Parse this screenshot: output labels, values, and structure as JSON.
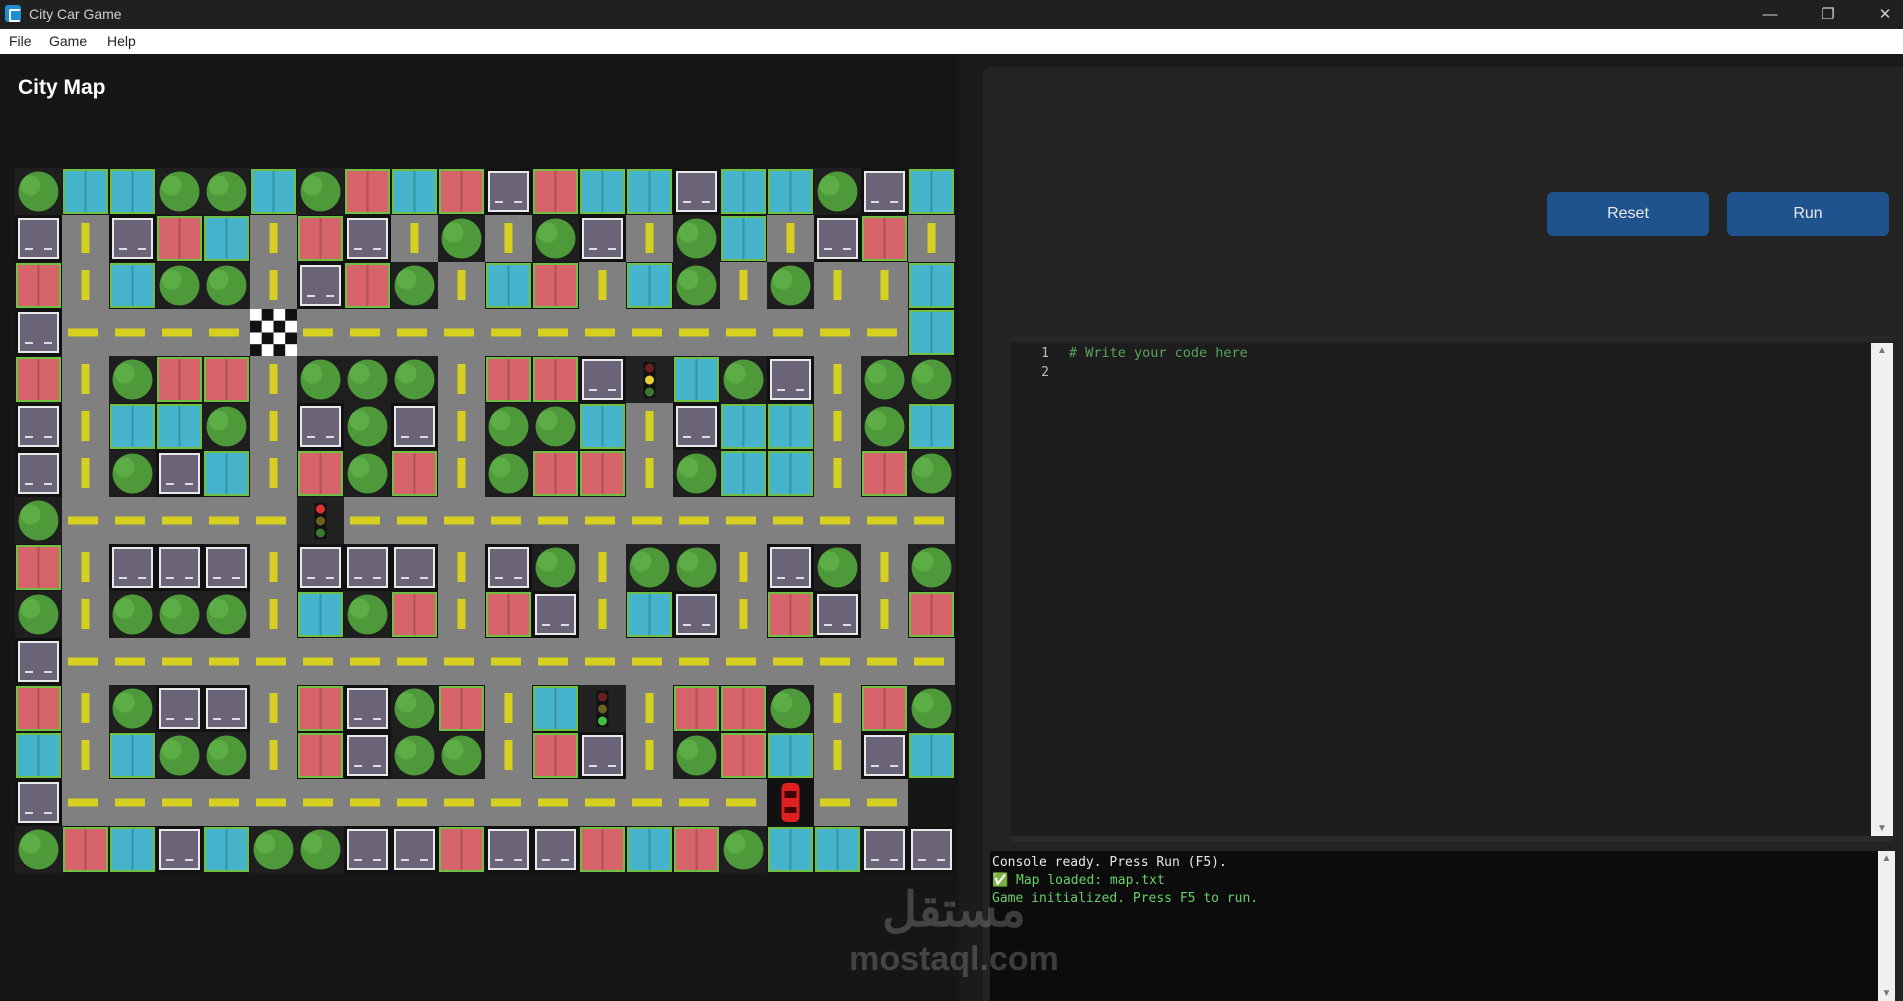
{
  "window": {
    "title": "City Car Game",
    "minimize_glyph": "—",
    "maximize_glyph": "❐",
    "close_glyph": "✕"
  },
  "menu": [
    "File",
    "Game",
    "Help"
  ],
  "map": {
    "title": "City Map",
    "grid": [
      "TCCTTCTRCRGRCCGCCTGC",
      "G.GRC.RG.T.TG.TC.GR.",
      "R.CTT.GRT.CR.CT.T..C",
      "G....F.............C",
      "R.TRR.TTT.RRG.CTG.TT",
      "G.CCT.GTG.TTC.GCC.TC",
      "G.TGC.RTR.TRR.TCC.RT",
      "T...................T",
      "R.GGG.GGG.GT.TT.GT.T",
      "T.TTT.CTR.RG.CG.RG.R",
      "G...................T",
      "R.TGG.RGTR.CC.RRT.RTT",
      "C.CTT.RGTT.RG.TRC.GCR",
      "G..................",
      "TRCGCTTGGRGGRCRTCCGG"
    ],
    "traffic_lights": [
      {
        "row": 4,
        "col": 13,
        "state": "yellow"
      },
      {
        "row": 7,
        "col": 6,
        "state": "red"
      },
      {
        "row": 11,
        "col": 12,
        "state": "green"
      }
    ],
    "finish": {
      "row": 3,
      "col": 5
    },
    "car": {
      "row": 13,
      "col": 16,
      "color": "#e02020"
    },
    "colors": {
      "road": "#808080",
      "lane_mark": "#d8d020",
      "tree": "#4e9a3a",
      "building_red": "#d6646a",
      "building_cyan": "#45b4cc",
      "building_gray": "#6b6478",
      "grass_border": "#6fbf40"
    }
  },
  "controls": {
    "reset_label": "Reset",
    "run_label": "Run"
  },
  "editor": {
    "line_numbers": [
      "1",
      "2"
    ],
    "code_lines": [
      "# Write your code here",
      ""
    ]
  },
  "console": {
    "lines": [
      {
        "text": "Console ready. Press Run (F5).",
        "color": "#e8e8e8"
      },
      {
        "text": "✅ Map loaded: map.txt",
        "color": "#68d068"
      },
      {
        "text": "Game initialized. Press F5 to run.",
        "color": "#68d068"
      }
    ]
  },
  "watermark": {
    "arabic": "مستقل",
    "latin": "mostaql.com"
  }
}
